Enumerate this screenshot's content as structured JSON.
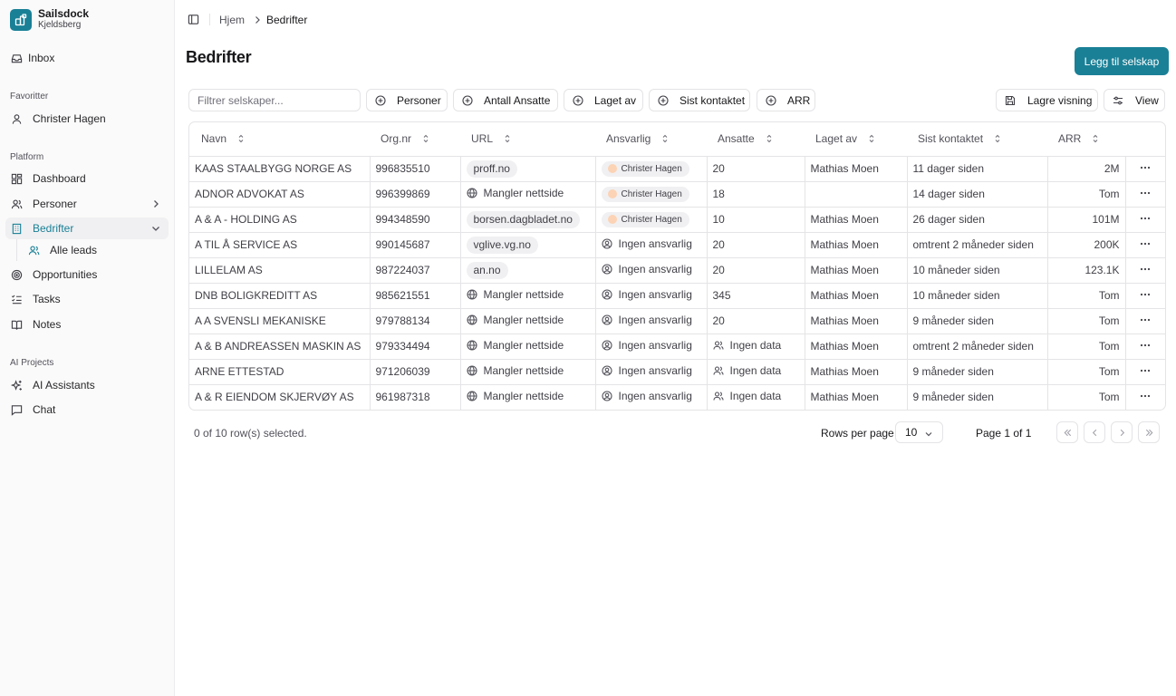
{
  "brand": {
    "name": "Sailsdock",
    "subtitle": "Kjeldsberg"
  },
  "sidebar": {
    "inbox": "Inbox",
    "favorites_label": "Favoritter",
    "favorites": [
      {
        "label": "Christer Hagen"
      }
    ],
    "platform_label": "Platform",
    "platform": [
      {
        "label": "Dashboard"
      },
      {
        "label": "Personer"
      },
      {
        "label": "Bedrifter"
      },
      {
        "label": "Alle leads"
      },
      {
        "label": "Opportunities"
      },
      {
        "label": "Tasks"
      },
      {
        "label": "Notes"
      }
    ],
    "ai_label": "AI Projects",
    "ai": [
      {
        "label": "AI Assistants"
      },
      {
        "label": "Chat"
      }
    ]
  },
  "breadcrumb": {
    "home": "Hjem",
    "current": "Bedrifter"
  },
  "page": {
    "title": "Bedrifter",
    "add_button": "Legg til selskap"
  },
  "toolbar": {
    "filter_placeholder": "Filtrer selskaper...",
    "filters": [
      "Personer",
      "Antall Ansatte",
      "Laget av",
      "Sist kontaktet",
      "ARR"
    ],
    "save_view": "Lagre visning",
    "view": "View"
  },
  "table": {
    "columns": [
      "Navn",
      "Org.nr",
      "URL",
      "Ansvarlig",
      "Ansatte",
      "Laget av",
      "Sist kontaktet",
      "ARR"
    ],
    "rows": [
      {
        "name": "KAAS STAALBYGG NORGE AS",
        "org": "996835510",
        "url": "proff.no",
        "url_missing": false,
        "owner": "Christer Hagen",
        "has_owner": true,
        "employees": "20",
        "has_employees": true,
        "created_by": "Mathias Moen",
        "last_contact": "11 dager siden",
        "arr": "2M"
      },
      {
        "name": "ADNOR ADVOKAT AS",
        "org": "996399869",
        "url": "Mangler nettside",
        "url_missing": true,
        "owner": "Christer Hagen",
        "has_owner": true,
        "employees": "18",
        "has_employees": true,
        "created_by": "",
        "last_contact": "14 dager siden",
        "arr": "Tom"
      },
      {
        "name": "A & A - HOLDING AS",
        "org": "994348590",
        "url": "borsen.dagbladet.no",
        "url_missing": false,
        "owner": "Christer Hagen",
        "has_owner": true,
        "employees": "10",
        "has_employees": true,
        "created_by": "Mathias Moen",
        "last_contact": "26 dager siden",
        "arr": "101M"
      },
      {
        "name": "A TIL Å SERVICE AS",
        "org": "990145687",
        "url": "vglive.vg.no",
        "url_missing": false,
        "owner": "Ingen ansvarlig",
        "has_owner": false,
        "employees": "20",
        "has_employees": true,
        "created_by": "Mathias Moen",
        "last_contact": "omtrent 2 måneder siden",
        "arr": "200K"
      },
      {
        "name": "LILLELAM AS",
        "org": "987224037",
        "url": "an.no",
        "url_missing": false,
        "owner": "Ingen ansvarlig",
        "has_owner": false,
        "employees": "20",
        "has_employees": true,
        "created_by": "Mathias Moen",
        "last_contact": "10 måneder siden",
        "arr": "123.1K"
      },
      {
        "name": "DNB BOLIGKREDITT AS",
        "org": "985621551",
        "url": "Mangler nettside",
        "url_missing": true,
        "owner": "Ingen ansvarlig",
        "has_owner": false,
        "employees": "345",
        "has_employees": true,
        "created_by": "Mathias Moen",
        "last_contact": "10 måneder siden",
        "arr": "Tom"
      },
      {
        "name": "A A SVENSLI MEKANISKE",
        "org": "979788134",
        "url": "Mangler nettside",
        "url_missing": true,
        "owner": "Ingen ansvarlig",
        "has_owner": false,
        "employees": "20",
        "has_employees": true,
        "created_by": "Mathias Moen",
        "last_contact": "9 måneder siden",
        "arr": "Tom"
      },
      {
        "name": "A & B ANDREASSEN MASKIN AS",
        "org": "979334494",
        "url": "Mangler nettside",
        "url_missing": true,
        "owner": "Ingen ansvarlig",
        "has_owner": false,
        "employees": "Ingen data",
        "has_employees": false,
        "created_by": "Mathias Moen",
        "last_contact": "omtrent 2 måneder siden",
        "arr": "Tom"
      },
      {
        "name": "ARNE ETTESTAD",
        "org": "971206039",
        "url": "Mangler nettside",
        "url_missing": true,
        "owner": "Ingen ansvarlig",
        "has_owner": false,
        "employees": "Ingen data",
        "has_employees": false,
        "created_by": "Mathias Moen",
        "last_contact": "9 måneder siden",
        "arr": "Tom"
      },
      {
        "name": "A & R EIENDOM SKJERVØY AS",
        "org": "961987318",
        "url": "Mangler nettside",
        "url_missing": true,
        "owner": "Ingen ansvarlig",
        "has_owner": false,
        "employees": "Ingen data",
        "has_employees": false,
        "created_by": "Mathias Moen",
        "last_contact": "9 måneder siden",
        "arr": "Tom"
      }
    ]
  },
  "footer": {
    "selection": "0 of 10 row(s) selected.",
    "rows_per_page_label": "Rows per page",
    "rows_per_page": "10",
    "page_info": "Page 1 of 1"
  },
  "colors": {
    "accent": "#1a8096",
    "border": "#e4e4e7",
    "sidebar_bg": "#fafafa"
  }
}
